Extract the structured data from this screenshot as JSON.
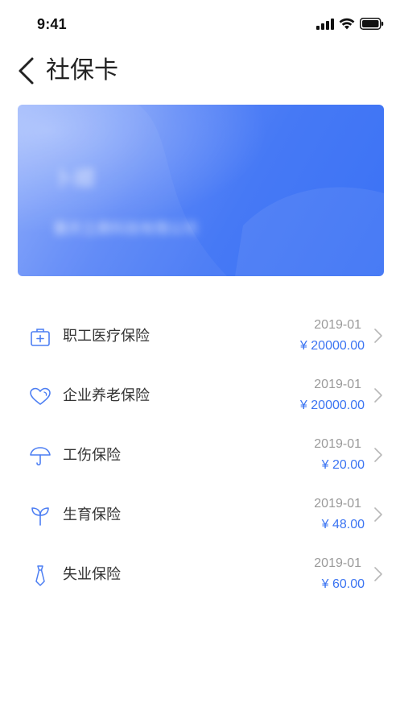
{
  "status_bar": {
    "time": "9:41"
  },
  "nav": {
    "title": "社保卡"
  },
  "card": {
    "name": "卜顺",
    "company": "重庆立鼎科技有限公司"
  },
  "colors": {
    "accent": "#3b74f2",
    "icon": "#4c7ef3",
    "date": "#9a9a9a",
    "chevron": "#b8b8b8"
  },
  "items": [
    {
      "name": "职工医疗保险",
      "date": "2019-01",
      "amount": "¥ 20000.00",
      "icon": "medical-kit-icon"
    },
    {
      "name": "企业养老保险",
      "date": "2019-01",
      "amount": "¥ 20000.00",
      "icon": "heart-icon"
    },
    {
      "name": "工伤保险",
      "date": "2019-01",
      "amount": "¥ 20.00",
      "icon": "umbrella-icon"
    },
    {
      "name": "生育保险",
      "date": "2019-01",
      "amount": "¥ 48.00",
      "icon": "sprout-icon"
    },
    {
      "name": "失业保险",
      "date": "2019-01",
      "amount": "¥ 60.00",
      "icon": "tie-icon"
    }
  ]
}
